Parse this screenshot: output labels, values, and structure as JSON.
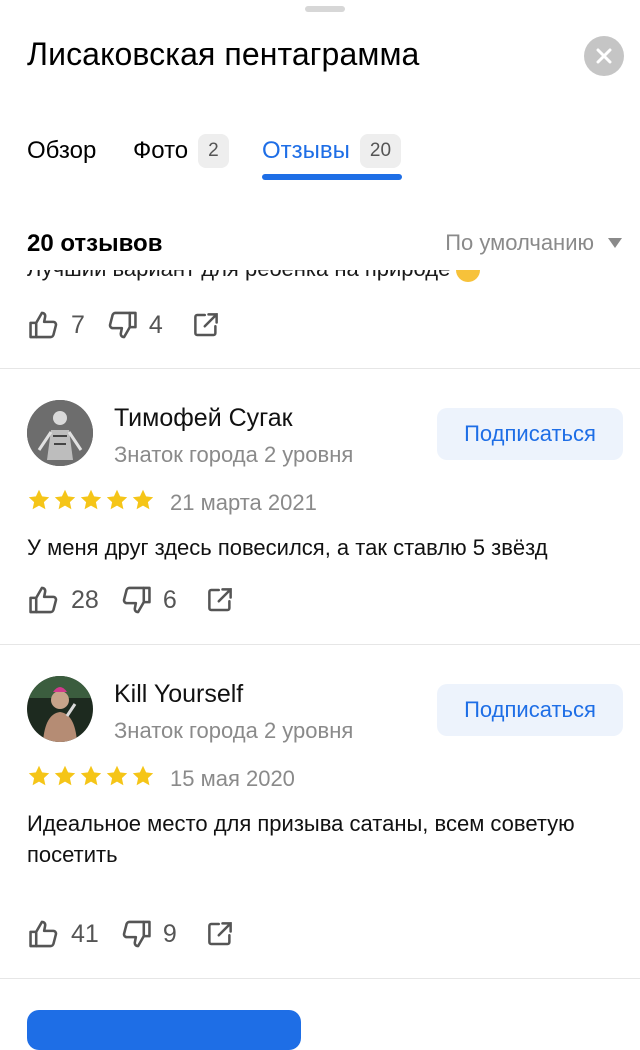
{
  "header": {
    "title": "Лисаковская пентаграмма"
  },
  "tabs": [
    {
      "label": "Обзор",
      "badge": null
    },
    {
      "label": "Фото",
      "badge": "2"
    },
    {
      "label": "Отзывы",
      "badge": "20",
      "active": true
    }
  ],
  "reviews_header": {
    "count": "20 отзывов",
    "sort": "По умолчанию"
  },
  "partial_review": {
    "text": "Лучший вариант для ребенка на природе",
    "likes": "7",
    "dislikes": "4"
  },
  "reviews": [
    {
      "author": "Тимофей Сугак",
      "level": "Знаток города 2 уровня",
      "subscribe": "Подписаться",
      "rating": 5,
      "date": "21 марта 2021",
      "text": "У меня друг здесь повесился, а так ставлю 5 звёзд",
      "likes": "28",
      "dislikes": "6"
    },
    {
      "author": "Kill Yourself",
      "level": "Знаток города 2 уровня",
      "subscribe": "Подписаться",
      "rating": 5,
      "date": "15 мая 2020",
      "text": "Идеальное место для призыва сатаны, всем советую посетить",
      "likes": "41",
      "dislikes": "9"
    }
  ],
  "colors": {
    "accent": "#1e6ee6",
    "star": "#f5c518",
    "muted": "#8a8a8a"
  }
}
